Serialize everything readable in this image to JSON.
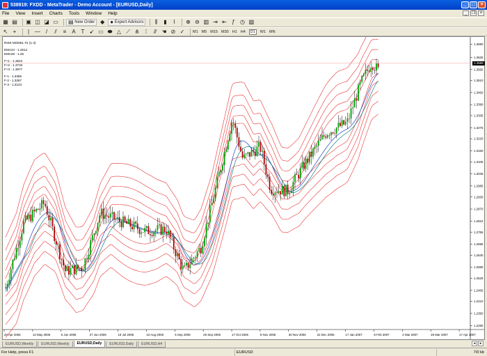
{
  "window": {
    "title": "538919: FXDD - MetaTrader - Demo Account - [EURUSD,Daily]"
  },
  "menu": {
    "items": [
      "File",
      "View",
      "Insert",
      "Charts",
      "Tools",
      "Window",
      "Help"
    ]
  },
  "toolbar": {
    "new_order_label": "New Order",
    "expert_advisors_label": "Expert Advisors",
    "timeframes": [
      "M1",
      "M5",
      "M15",
      "M30",
      "H1",
      "H4",
      "D1",
      "W1",
      "MN"
    ],
    "active_timeframe": "D1"
  },
  "chart": {
    "symbol": "EURUSD",
    "legend": {
      "title": "RISK MODEL #1 (1-4)",
      "ema_lines": [
        "EMA24 - 1.2512",
        "EMA26 - 1.25"
      ],
      "plus_lines": [
        "F+1 - 1.3644",
        "F+2 - 1.3733",
        "F+3 - 1.3877"
      ],
      "minus_lines": [
        "F-1 - 1.3356",
        "F-2 - 1.3267",
        "F-3 - 1.3123"
      ]
    },
    "current_price": "1.3596",
    "price_ticks": [
      "1.3690",
      "1.3625",
      "1.3565",
      "1.3510",
      "1.3450",
      "1.3390",
      "1.3335",
      "1.3275",
      "1.3220",
      "1.3160",
      "1.3105",
      "1.3045",
      "1.2985",
      "1.2930",
      "1.2870",
      "1.2810",
      "1.2755",
      "1.2695",
      "1.2640",
      "1.2580",
      "1.2525",
      "1.2465",
      "1.2410",
      "1.2350",
      "1.2290"
    ],
    "date_ticks": [
      "20 Apr 2006",
      "12 May 2006",
      "6 Jun 2006",
      "27 Jun 2006",
      "19 Jul 2006",
      "10 Aug 2006",
      "5 Sep 2006",
      "25 Sep 2006",
      "17 Oct 2006",
      "8 Nov 2006",
      "30 Nov 2006",
      "22 Dec 2006",
      "17 Jan 2007",
      "8 Feb 2007",
      "2 Mar 2007",
      "26 Mar 2007",
      "17 Apr 2007"
    ],
    "colors": {
      "bull": "#00a000",
      "bear": "#b00000",
      "band": "#e83030",
      "ema_blue": "#2040c0",
      "ema_teal": "#108080"
    }
  },
  "tabs": {
    "items": [
      "EURUSD,Weekly",
      "EURUSD,Weekly",
      "EURUSD,Daily",
      "EURUSD,Daily",
      "EURUSD,H4"
    ],
    "active_index": 2
  },
  "status": {
    "help": "For Help, press F1",
    "symbol": "EURUSD",
    "traffic": "7/0 kb"
  }
}
